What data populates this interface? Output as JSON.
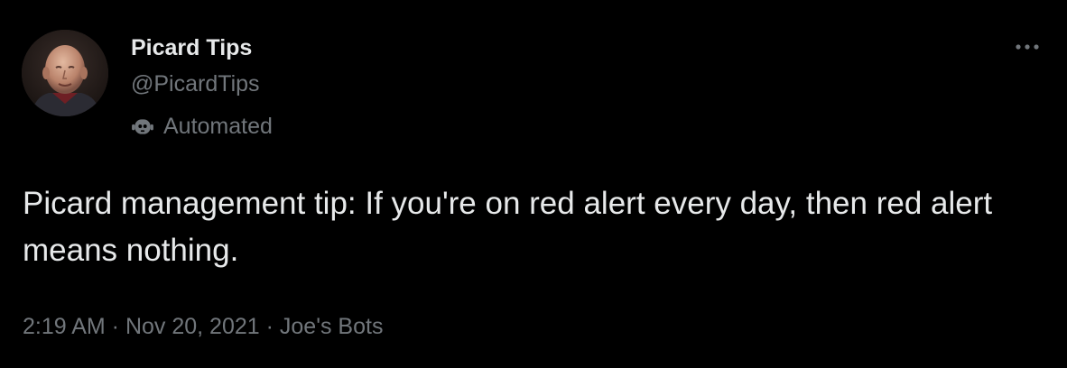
{
  "tweet": {
    "display_name": "Picard Tips",
    "handle": "@PicardTips",
    "label": "Automated",
    "text": "Picard management tip: If you're on red alert every day, then red alert means nothing.",
    "time": "2:19 AM",
    "date": "Nov 20, 2021",
    "source": "Joe's Bots",
    "separator": " · ",
    "more_icon": "more-horizontal-icon",
    "bot_icon": "robot-icon"
  },
  "colors": {
    "background": "#000000",
    "primary_text": "#e7e9ea",
    "secondary_text": "#71767b"
  }
}
